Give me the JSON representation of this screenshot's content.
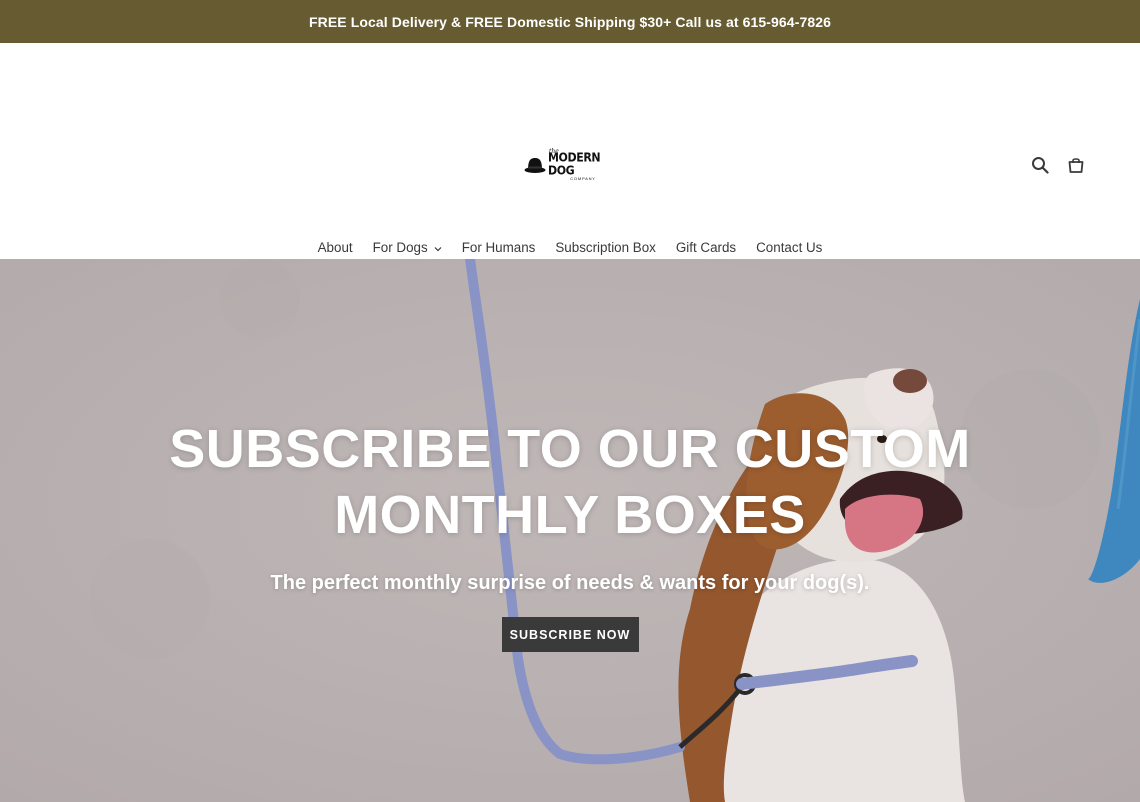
{
  "announcement": {
    "text": "FREE Local Delivery & FREE Domestic Shipping $30+ Call us at 615-964-7826"
  },
  "header": {
    "logo": {
      "the": "the",
      "main": "MODERN DOG",
      "sub": "COMPANY"
    },
    "icons": [
      "search-icon",
      "cart-icon"
    ]
  },
  "nav": {
    "items": [
      {
        "label": "About"
      },
      {
        "label": "For Dogs"
      },
      {
        "label": "For Humans"
      },
      {
        "label": "Subscription Box"
      },
      {
        "label": "Gift Cards"
      },
      {
        "label": "Contact Us"
      }
    ]
  },
  "hero": {
    "title_line1": "SUBSCRIBE TO OUR CUSTOM",
    "title_line2": "MONTHLY BOXES",
    "subtitle": "The perfect monthly surprise of needs & wants for your dog(s).",
    "button_label": "SUBSCRIBE NOW"
  },
  "colors": {
    "announcement_bg": "#675c31",
    "button_bg": "#3a3a3a",
    "leash": "#8f9acf",
    "hero_bg": "#c3bbbb"
  }
}
